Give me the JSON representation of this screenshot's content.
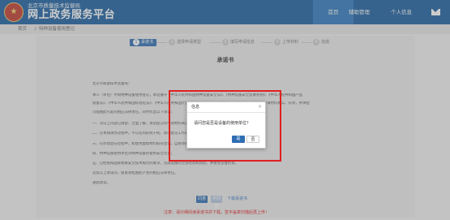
{
  "header": {
    "agency": "北京市质量技术监督局",
    "title": "网上政务服务平台",
    "nav": {
      "home": "首页",
      "setup": "辅助管理",
      "personal": "个人信息"
    },
    "mail_icon": "envelope-icon"
  },
  "breadcrumb": {
    "home": "首页",
    "separator": "/",
    "current": "特种设备使用登记"
  },
  "steps": [
    {
      "num": "1",
      "label": "承诺书"
    },
    {
      "num": "2",
      "label": "选择申请类型"
    },
    {
      "num": "3",
      "label": "填写申请信息"
    },
    {
      "num": "4",
      "label": "上传材料"
    },
    {
      "num": "5",
      "label": "完成"
    }
  ],
  "document": {
    "title": "承诺书",
    "paragraphs": [
      "北京市质量技术监督局：",
      "本人（单位）申请特种设备使用登记，承诺遵守《中华人民共和国特种设备安全法》、《特种设备安全监察条例》、《中华人民共和国产品",
      "质量法》、《中华人民共和国标准化法》、《中华人民共和国计量法》及相关安全技术规范的规定，所提交的全部申请材料真实、有效，并承担",
      "可能由此引起的相应法律责任，同时作出以下承诺：",
      "一、对以上内容已清楚、全面了解，承诺提交的申请材料真实、完整、有效；",
      "二、在本期承办过程中，不以任何形式干扰、影响登记工作的正常进行；",
      "三、在办理登记过程中，如使用虚假材料取得登记，自愿承担相应的法律责任，接受依法查处；",
      "四、特种设备使用单位对特种设备的使用安全负责；",
      "五、已经按照国家相关安全技术规范的要求，完成设备的全部检验和试验，并接受监督检查。",
      "违反以上承诺的，愿意承担由此产生的相应法律责任。",
      "谨此承诺。"
    ],
    "agree": "同意",
    "disagree": "不同意",
    "download": "下载承诺书",
    "notice": "注意：请仔细阅读承诺书并下载，签字盖章扫描后再上传！"
  },
  "dialog": {
    "title": "信息",
    "message": "请问您是否是设备的使用单位？",
    "yes": "是",
    "no": "否",
    "close": "×"
  },
  "colors": {
    "header": "#1a5fa0",
    "accent": "#2e6db3",
    "highlight": "#e02020"
  }
}
